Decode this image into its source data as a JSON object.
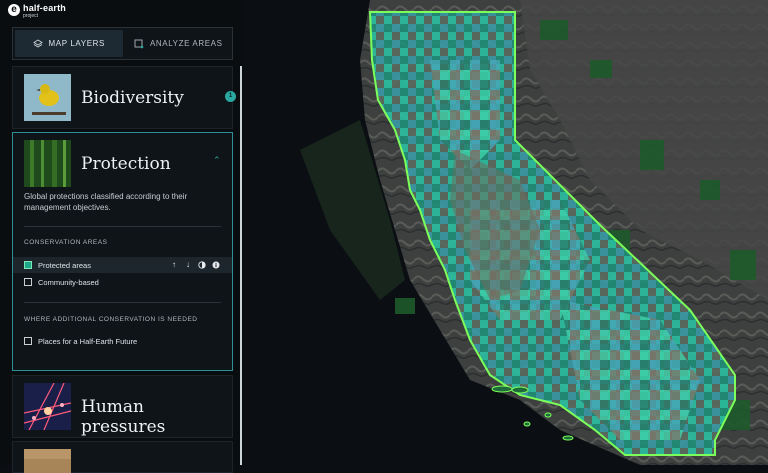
{
  "app": {
    "logo_name": "half-earth",
    "logo_sub": "project"
  },
  "tabs": [
    {
      "label": "MAP LAYERS",
      "active": true
    },
    {
      "label": "ANALYZE AREAS",
      "active": false
    }
  ],
  "cards": {
    "biodiversity": {
      "title": "Biodiversity",
      "badge": "1"
    },
    "protection": {
      "title": "Protection",
      "description": "Global protections classified according to their management objectives.",
      "section_conservation": "CONSERVATION AREAS",
      "layers": [
        {
          "label": "Protected areas",
          "checked": true
        },
        {
          "label": "Community-based",
          "checked": false
        }
      ],
      "section_additional": "WHERE ADDITIONAL CONSERVATION IS NEEDED",
      "additional_layers": [
        {
          "label": "Places for a Half-Earth Future",
          "checked": false
        }
      ]
    },
    "human_pressures": {
      "title": "Human pressures"
    }
  },
  "icons": {
    "layers": "layers-icon",
    "analyze": "analyze-areas-icon",
    "arrow_up": "arrow-up-icon",
    "arrow_down": "arrow-down-icon",
    "opacity": "opacity-icon",
    "info": "info-icon",
    "chevron": "chevron-up-icon"
  },
  "colors": {
    "accent": "#2aa7a0",
    "protected_fill": "#22c7a0",
    "state_outline": "#7cff5a",
    "background": "#0a0d10"
  }
}
